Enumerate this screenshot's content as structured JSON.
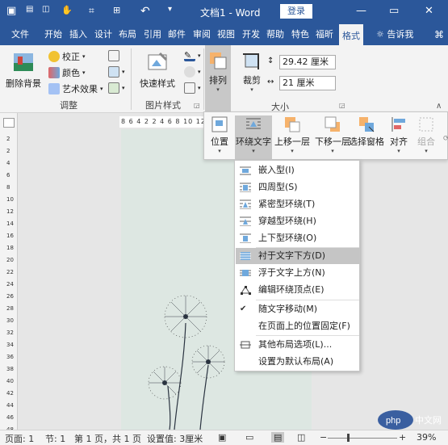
{
  "window": {
    "title": "文档1 - Word",
    "login": "登录",
    "minimize_icon": "—",
    "restore_icon": "▭",
    "close_icon": "✕",
    "save_icon": "▣",
    "undo_icon": "↶",
    "redo_icon": "↷",
    "touch_icon": "✋",
    "customize_icon": "▾"
  },
  "tabs": [
    {
      "label": "文件"
    },
    {
      "label": "开始"
    },
    {
      "label": "插入"
    },
    {
      "label": "设计"
    },
    {
      "label": "布局"
    },
    {
      "label": "引用"
    },
    {
      "label": "邮件"
    },
    {
      "label": "审阅"
    },
    {
      "label": "视图"
    },
    {
      "label": "开发"
    },
    {
      "label": "帮助"
    },
    {
      "label": "特色"
    },
    {
      "label": "福昕"
    },
    {
      "label": "格式"
    }
  ],
  "tell_me": "告诉我",
  "ribbon": {
    "remove_bg": "删除背景",
    "corrections": "校正",
    "color": "颜色",
    "artistic": "艺术效果",
    "adjust_group": "调整",
    "quick_styles": "快速样式",
    "picture_styles_group": "图片样式",
    "arrange": "排列",
    "crop": "裁剪",
    "height": "29.42 厘米",
    "width": "21 厘米",
    "size_group": "大小"
  },
  "hruler_text": "8 6 4 2  2 4 6 8 10 12",
  "vruler_nums": [
    "2",
    "2",
    "4",
    "6",
    "8",
    "10",
    "12",
    "14",
    "16",
    "18",
    "20",
    "22",
    "24",
    "26",
    "28",
    "30",
    "32",
    "34",
    "36",
    "38",
    "40",
    "42",
    "44",
    "46",
    "48"
  ],
  "arrange_panel": {
    "position": "位置",
    "wrap_text": "环绕文字",
    "bring_forward": "上移一层",
    "send_backward": "下移一层",
    "selection_pane": "选择窗格",
    "align": "对齐",
    "group": "组合"
  },
  "wrap_menu": {
    "items": [
      {
        "label": "嵌入型(I)"
      },
      {
        "label": "四周型(S)"
      },
      {
        "label": "紧密型环绕(T)"
      },
      {
        "label": "穿越型环绕(H)"
      },
      {
        "label": "上下型环绕(O)"
      },
      {
        "label": "衬于文字下方(D)"
      },
      {
        "label": "浮于文字上方(N)"
      },
      {
        "label": "编辑环绕顶点(E)"
      },
      {
        "label": "随文字移动(M)"
      },
      {
        "label": "在页面上的位置固定(F)"
      },
      {
        "label": "其他布局选项(L)..."
      },
      {
        "label": "设置为默认布局(A)"
      }
    ],
    "checked_icon": "✔"
  },
  "status": {
    "page": "页面: 1",
    "section": "节: 1",
    "page_of": "第 1 页，共 1 页",
    "setting": "设置值: 3厘米",
    "zoom_minus": "−",
    "zoom_plus": "+",
    "zoom": "39%"
  },
  "watermark": "php 中文网",
  "colors": {
    "word_blue": "#2b579a",
    "ribbon_bg": "#f3f3f3",
    "page_bg": "#dde7e2",
    "highlight": "#c5c5c5"
  }
}
